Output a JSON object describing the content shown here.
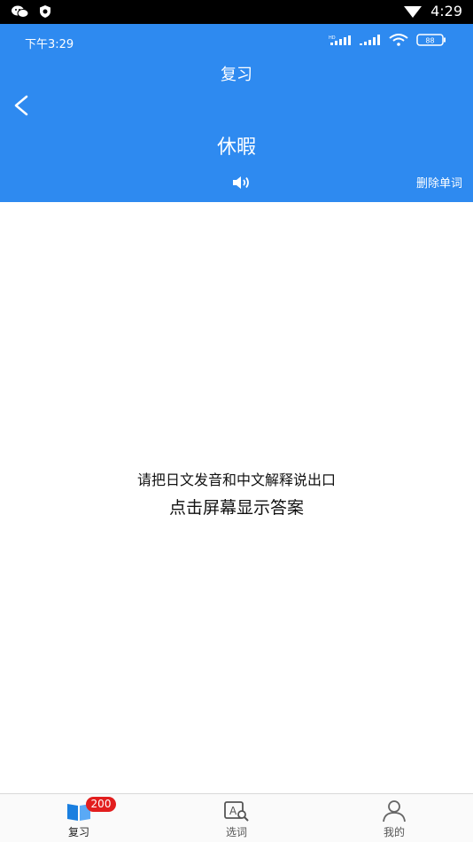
{
  "system_bar": {
    "time": "4:29"
  },
  "header": {
    "phone_time": "下午3:29",
    "battery": "88",
    "title": "复习",
    "word": "休暇",
    "delete_label": "删除单词"
  },
  "content": {
    "prompt": "请把日文发音和中文解释说出口",
    "tap_hint": "点击屏幕显示答案"
  },
  "tabs": [
    {
      "label": "复习",
      "badge": "200",
      "icon": "book-icon"
    },
    {
      "label": "选词",
      "icon": "search-word-icon"
    },
    {
      "label": "我的",
      "icon": "user-icon"
    }
  ],
  "colors": {
    "header_bg": "#2e8af0",
    "badge_bg": "#e21e1e",
    "icon_blue": "#1a7fe0"
  }
}
